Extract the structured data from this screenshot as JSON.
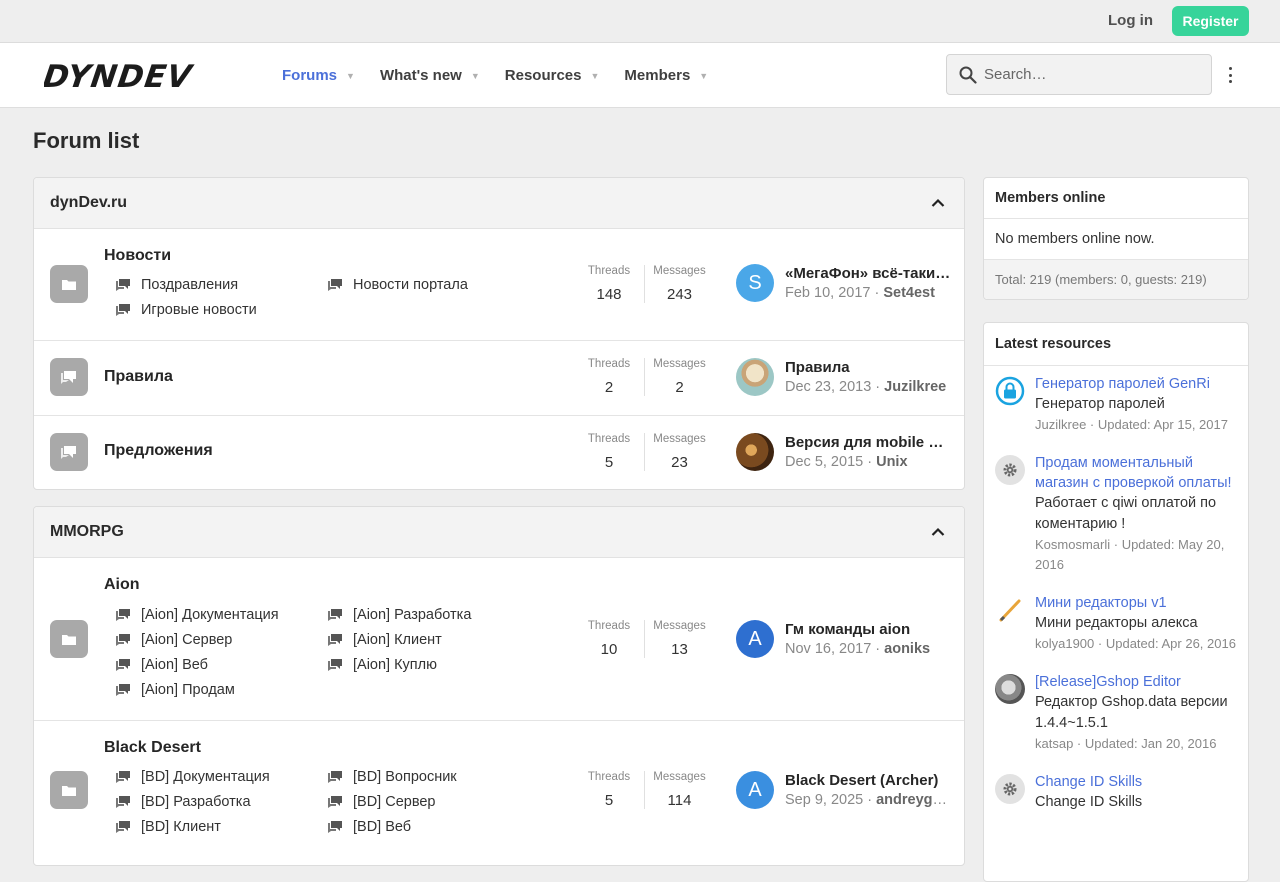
{
  "topbar": {
    "login": "Log in",
    "register": "Register"
  },
  "header": {
    "logo_text": "DYNDEV",
    "nav": [
      {
        "label": "Forums",
        "active": true
      },
      {
        "label": "What's new",
        "active": false
      },
      {
        "label": "Resources",
        "active": false
      },
      {
        "label": "Members",
        "active": false
      }
    ],
    "search_placeholder": "Search…"
  },
  "page_title": "Forum list",
  "categories": [
    {
      "title": "dynDev.ru",
      "nodes": [
        {
          "title": "Новости",
          "subforums": [
            "Поздравления",
            "Новости портала",
            "Игровые новости"
          ],
          "threads_label": "Threads",
          "threads": "148",
          "messages_label": "Messages",
          "messages": "243",
          "last_title": "«МегаФон» всё-таки пошёл",
          "last_date": "Feb 10, 2017",
          "last_user": "Set4est",
          "avatar_letter": "S",
          "avatar_color": "#4aa7e8"
        },
        {
          "title": "Правила",
          "subforums": [],
          "threads_label": "Threads",
          "threads": "2",
          "messages_label": "Messages",
          "messages": "2",
          "last_title": "Правила",
          "last_date": "Dec 23, 2013",
          "last_user": "Juzilkree",
          "avatar_letter": "",
          "avatar_color": "#cfd9c8"
        },
        {
          "title": "Предложения",
          "subforums": [],
          "threads_label": "Threads",
          "threads": "5",
          "messages_label": "Messages",
          "messages": "23",
          "last_title": "Версия для mobile устройств",
          "last_date": "Dec 5, 2015",
          "last_user": "Unix",
          "avatar_letter": "",
          "avatar_color": "#8a5a2b"
        }
      ]
    },
    {
      "title": "MMORPG",
      "nodes": [
        {
          "title": "Aion",
          "subforums": [
            "[Aion] Документация",
            "[Aion] Разработка",
            "[Aion] Сервер",
            "[Aion] Клиент",
            "[Aion] Веб",
            "[Aion] Куплю",
            "[Aion] Продам"
          ],
          "threads_label": "Threads",
          "threads": "10",
          "messages_label": "Messages",
          "messages": "13",
          "last_title": "Гм команды aion",
          "last_date": "Nov 16, 2017",
          "last_user": "aoniks",
          "avatar_letter": "A",
          "avatar_color": "#2e6fd0"
        },
        {
          "title": "Black Desert",
          "subforums": [
            "[BD] Документация",
            "[BD] Вопросник",
            "[BD] Разработка",
            "[BD] Сервер",
            "[BD] Клиент",
            "[BD] Веб"
          ],
          "threads_label": "Threads",
          "threads": "5",
          "messages_label": "Messages",
          "messages": "114",
          "last_title": "Black Desert (Archer)",
          "last_date": "Sep 9, 2025",
          "last_user": "andreyglobus",
          "avatar_letter": "A",
          "avatar_color": "#3a8fe0"
        }
      ]
    }
  ],
  "members_online": {
    "title": "Members online",
    "body": "No members online now.",
    "footer": "Total: 219 (members: 0, guests: 219)"
  },
  "latest_resources": {
    "title": "Latest resources",
    "items": [
      {
        "title": "Генератор паролей GenRi",
        "desc": "Генератор паролей",
        "author": "Juzilkree",
        "updated": "Updated: Apr 15, 2017",
        "icon": "lock-icon"
      },
      {
        "title": "Продам моментальный магазин с проверкой оплаты!",
        "desc": "Работает с qiwi оплатой по коментарию !",
        "author": "Kosmosmarli",
        "updated": "Updated: May 20, 2016",
        "icon": "gear-icon"
      },
      {
        "title": "Мини редакторы v1",
        "desc": "Мини редакторы алекса",
        "author": "kolya1900",
        "updated": "Updated: Apr 26, 2016",
        "icon": "pencil-icon"
      },
      {
        "title": "[Release]Gshop Editor",
        "desc": "Редактор Gshop.data версии 1.4.4~1.5.1",
        "author": "katsap",
        "updated": "Updated: Jan 20, 2016",
        "icon": "gshop-icon"
      },
      {
        "title": "Change ID Skills",
        "desc": "Change ID Skills",
        "author": "",
        "updated": "",
        "icon": "gear-icon"
      }
    ]
  },
  "colors": {
    "accent": "#4b70d9",
    "register": "#37d49a",
    "node_icon": "#a9a9a9"
  }
}
